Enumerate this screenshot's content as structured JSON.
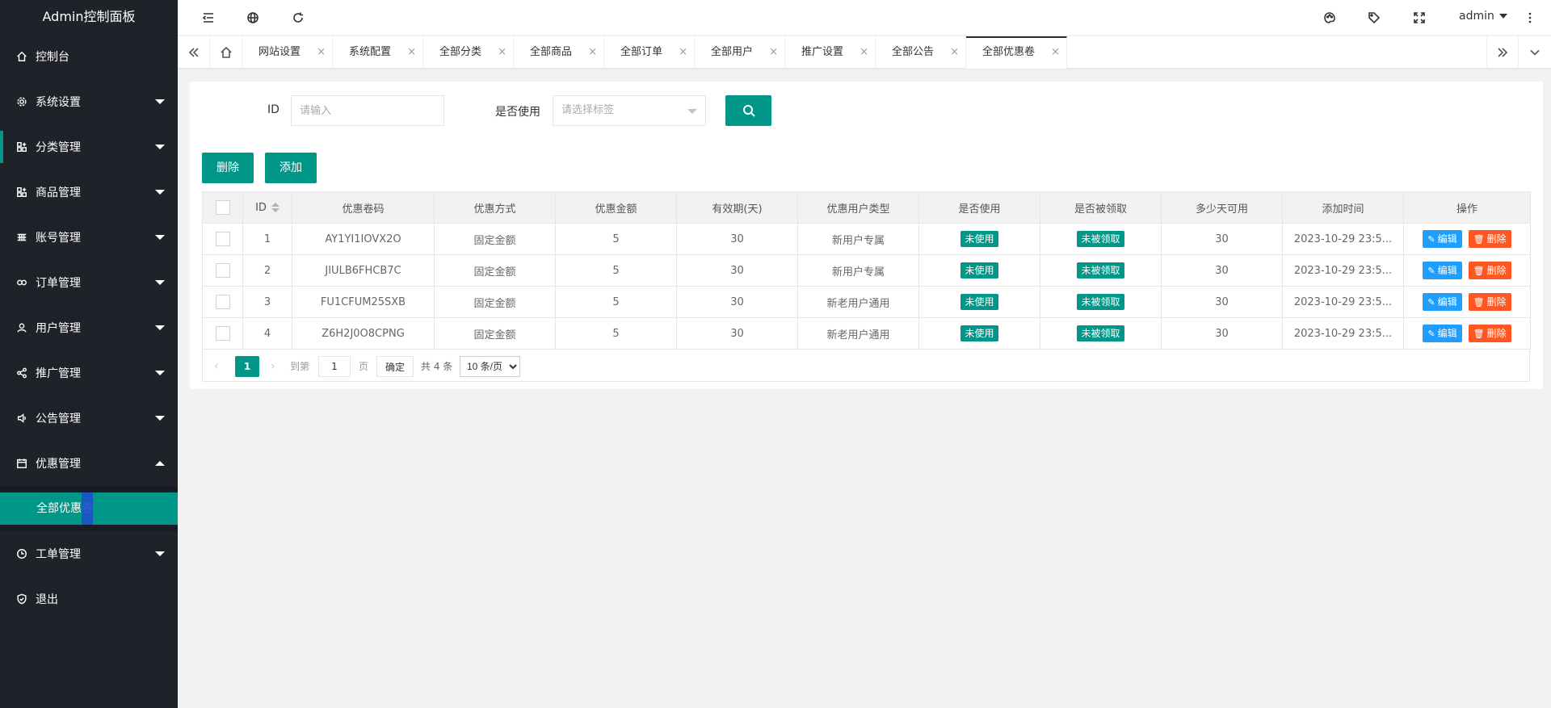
{
  "app_title": "Admin控制面板",
  "sidebar": {
    "items": [
      {
        "label": "控制台",
        "icon": "home-icon",
        "has_children": false
      },
      {
        "label": "系统设置",
        "icon": "gear-icon",
        "has_children": true
      },
      {
        "label": "分类管理",
        "icon": "apps-add-icon",
        "has_children": true
      },
      {
        "label": "商品管理",
        "icon": "apps-add-icon",
        "has_children": true
      },
      {
        "label": "账号管理",
        "icon": "grid-icon",
        "has_children": true
      },
      {
        "label": "订单管理",
        "icon": "link-icon",
        "has_children": true
      },
      {
        "label": "用户管理",
        "icon": "user-icon",
        "has_children": true
      },
      {
        "label": "推广管理",
        "icon": "share-icon",
        "has_children": true
      },
      {
        "label": "公告管理",
        "icon": "speaker-icon",
        "has_children": true
      },
      {
        "label": "优惠管理",
        "icon": "calendar-icon",
        "has_children": true,
        "expanded": true
      },
      {
        "label": "工单管理",
        "icon": "clock-icon",
        "has_children": true
      },
      {
        "label": "退出",
        "icon": "shield-icon",
        "has_children": false
      }
    ],
    "active_sub_item": "全部优惠卷"
  },
  "header": {
    "icons": [
      "menu-fold-icon",
      "globe-icon",
      "refresh-icon",
      "palette-icon",
      "tag-icon",
      "fullscreen-icon",
      "more-vertical-icon"
    ],
    "user": "admin"
  },
  "tabs": {
    "items": [
      "网站设置",
      "系统配置",
      "全部分类",
      "全部商品",
      "全部订单",
      "全部用户",
      "推广设置",
      "全部公告",
      "全部优惠卷"
    ],
    "active": "全部优惠卷",
    "close_glyph": "×"
  },
  "search": {
    "id_label": "ID",
    "id_placeholder": "请输入",
    "used_label": "是否使用",
    "used_placeholder": "请选择标签"
  },
  "toolbar": {
    "delete_label": "删除",
    "add_label": "添加"
  },
  "table": {
    "columns": [
      "ID",
      "优惠卷码",
      "优惠方式",
      "优惠金额",
      "有效期(天)",
      "优惠用户类型",
      "是否使用",
      "是否被领取",
      "多少天可用",
      "添加时间",
      "操作"
    ],
    "rows": [
      {
        "id": "1",
        "code": "AY1YI1IOVX2O",
        "method": "固定金额",
        "amount": "5",
        "validity": "30",
        "user_type": "新用户专属",
        "used": "未使用",
        "claimed": "未被领取",
        "days": "30",
        "time": "2023-10-29 23:5..."
      },
      {
        "id": "2",
        "code": "JIULB6FHCB7C",
        "method": "固定金额",
        "amount": "5",
        "validity": "30",
        "user_type": "新用户专属",
        "used": "未使用",
        "claimed": "未被领取",
        "days": "30",
        "time": "2023-10-29 23:5..."
      },
      {
        "id": "3",
        "code": "FU1CFUM25SXB",
        "method": "固定金额",
        "amount": "5",
        "validity": "30",
        "user_type": "新老用户通用",
        "used": "未使用",
        "claimed": "未被领取",
        "days": "30",
        "time": "2023-10-29 23:5..."
      },
      {
        "id": "4",
        "code": "Z6H2J0O8CPNG",
        "method": "固定金额",
        "amount": "5",
        "validity": "30",
        "user_type": "新老用户通用",
        "used": "未使用",
        "claimed": "未被领取",
        "days": "30",
        "time": "2023-10-29 23:5..."
      }
    ],
    "edit_label": "编辑",
    "delete_label": "删除"
  },
  "pager": {
    "prev": "‹",
    "next": "›",
    "current_page": "1",
    "goto_label": "到第",
    "goto_value": "1",
    "page_unit": "页",
    "confirm_label": "确定",
    "total_label": "共 4 条",
    "page_size": "10 条/页"
  },
  "colors": {
    "sidebar_bg": "#20222a",
    "accent": "#009688",
    "edit_blue": "#1e9fff",
    "delete_orange": "#ff5722"
  }
}
